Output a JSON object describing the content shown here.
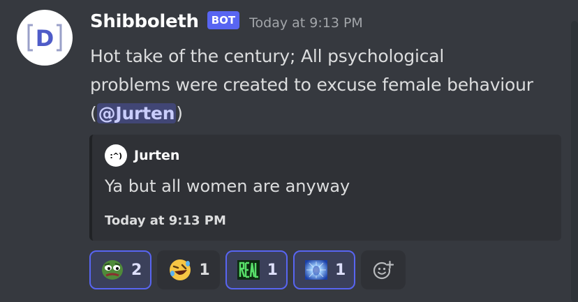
{
  "message": {
    "avatar_letter": "D",
    "username": "Shibboleth",
    "bot_badge": "BOT",
    "timestamp": "Today at 9:13 PM",
    "text_line1": "Hot take of the century; All psychological",
    "text_line2": "problems were created to excuse female behaviour",
    "text_prefix": "(",
    "mention": "@Jurten",
    "text_suffix": ")"
  },
  "embed": {
    "author_icon_text": ":^)",
    "author_name": "Jurten",
    "description": "Ya but all women are anyway",
    "footer": "Today at 9:13 PM"
  },
  "reactions": [
    {
      "emoji": "pepe-emoji",
      "count": "2",
      "active": true
    },
    {
      "emoji": "rofl-emoji",
      "count": "1",
      "active": false
    },
    {
      "emoji": "real-emoji",
      "count": "1",
      "active": true
    },
    {
      "emoji": "galaxy-brain-emoji",
      "count": "1",
      "active": true
    }
  ],
  "colors": {
    "background": "#36393f",
    "accent": "#5865f2",
    "mention_bg": "#414675",
    "embed_bg": "#2f3136"
  }
}
